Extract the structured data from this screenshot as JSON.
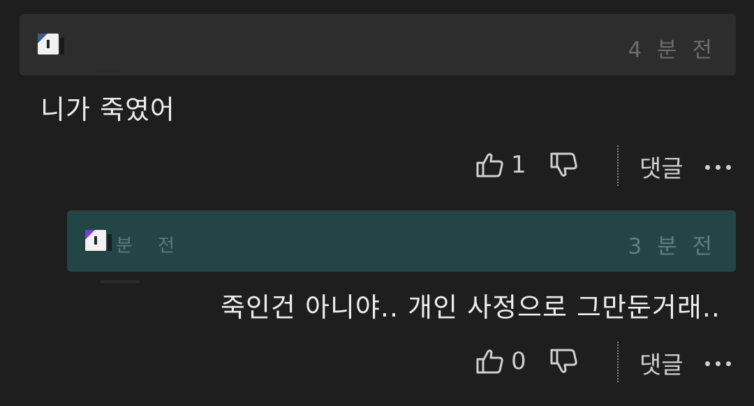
{
  "comments": [
    {
      "nickname": "",
      "time": "4 분 전",
      "text": "니가 죽였어",
      "likes": "1",
      "reply_label": "댓글"
    },
    {
      "nickname": "분 전",
      "time": "3 분 전",
      "text": "죽인건 아니야.. 개인 사정으로 그만둔거래..",
      "likes": "0",
      "reply_label": "댓글"
    }
  ],
  "icons": {
    "like": "thumbs-up-icon",
    "dislike": "thumbs-down-icon",
    "more": "more-dots-icon"
  },
  "colors": {
    "background": "#1e1e1e",
    "comment_header": "#2d2d2d",
    "reply_header": "#234545",
    "text": "#ededed",
    "muted": "#6c6c6c"
  }
}
